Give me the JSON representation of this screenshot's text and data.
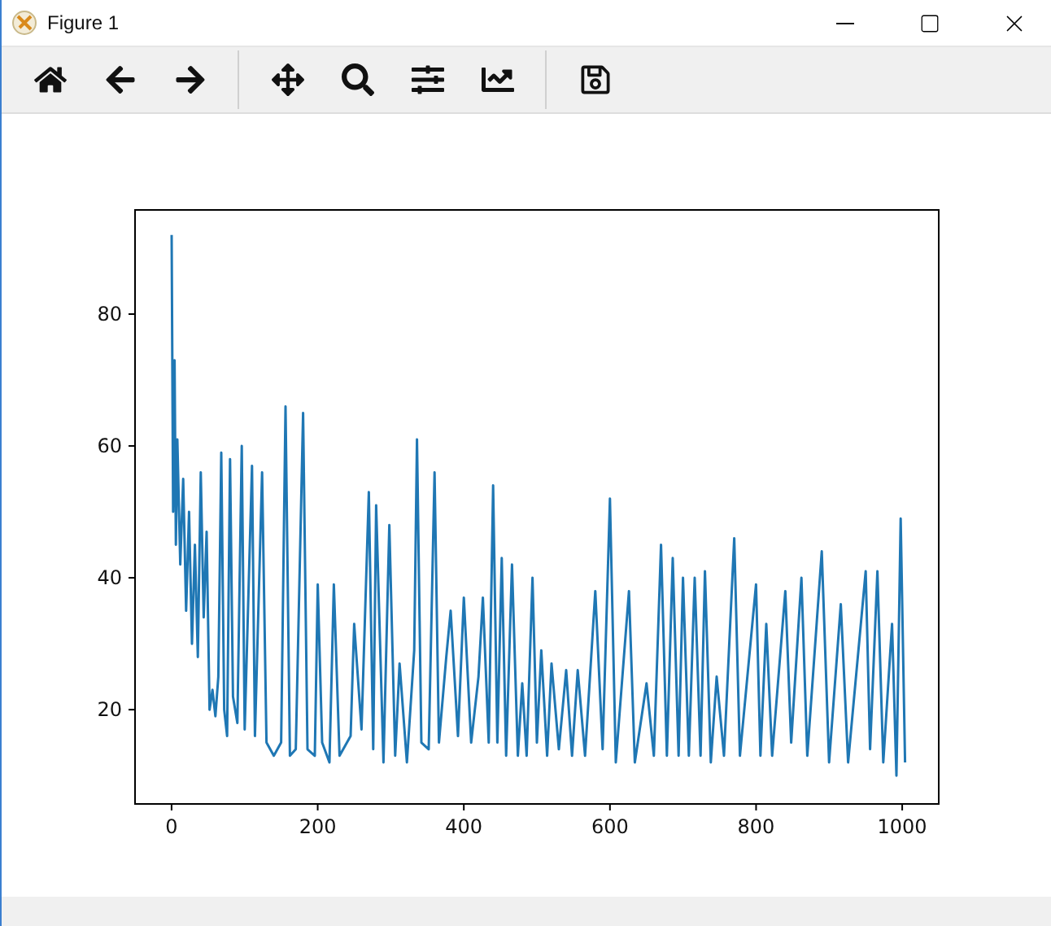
{
  "window": {
    "title": "Figure 1"
  },
  "figure": {
    "chart_data": {
      "type": "line",
      "xlim": [
        -50,
        1050
      ],
      "ylim": [
        5.7,
        95.8
      ],
      "xticks": [
        0,
        200,
        400,
        600,
        800,
        1000
      ],
      "yticks": [
        20,
        40,
        60,
        80
      ],
      "x": [
        0,
        2,
        4,
        6,
        8,
        12,
        16,
        20,
        24,
        28,
        32,
        36,
        40,
        44,
        48,
        52,
        56,
        60,
        64,
        68,
        72,
        76,
        80,
        84,
        90,
        96,
        100,
        110,
        114,
        124,
        130,
        140,
        150,
        156,
        162,
        170,
        180,
        186,
        196,
        200,
        206,
        216,
        222,
        230,
        245,
        250,
        260,
        270,
        276,
        280,
        290,
        298,
        306,
        312,
        322,
        332,
        336,
        342,
        352,
        360,
        366,
        376,
        382,
        392,
        400,
        410,
        420,
        426,
        434,
        440,
        446,
        452,
        458,
        466,
        474,
        480,
        486,
        494,
        500,
        506,
        514,
        520,
        530,
        540,
        548,
        556,
        566,
        580,
        590,
        600,
        608,
        626,
        634,
        650,
        660,
        670,
        678,
        686,
        694,
        700,
        708,
        716,
        724,
        730,
        738,
        746,
        756,
        770,
        778,
        800,
        806,
        814,
        822,
        840,
        848,
        862,
        870,
        890,
        900,
        916,
        926,
        950,
        956,
        966,
        974,
        986,
        992,
        998,
        1004
      ],
      "series": [
        {
          "color": "#1f77b4",
          "values": [
            92,
            50,
            73,
            45,
            61,
            42,
            55,
            35,
            50,
            30,
            45,
            28,
            56,
            34,
            47,
            20,
            23,
            19,
            25,
            59,
            20,
            16,
            58,
            22,
            18,
            60,
            17,
            57,
            16,
            56,
            15,
            13,
            15,
            66,
            13,
            14,
            65,
            14,
            13,
            39,
            15,
            12,
            39,
            13,
            16,
            33,
            17,
            53,
            14,
            51,
            12,
            48,
            13,
            27,
            12,
            29,
            61,
            15,
            14,
            56,
            15,
            28,
            35,
            16,
            37,
            15,
            25,
            37,
            15,
            54,
            15,
            43,
            13,
            42,
            13,
            24,
            13,
            40,
            15,
            29,
            13,
            27,
            14,
            26,
            13,
            26,
            13,
            38,
            14,
            52,
            12,
            38,
            12,
            24,
            13,
            45,
            13,
            43,
            13,
            40,
            13,
            40,
            13,
            41,
            12,
            25,
            13,
            46,
            13,
            39,
            13,
            33,
            13,
            38,
            15,
            40,
            13,
            44,
            12,
            36,
            12,
            41,
            14,
            41,
            12,
            33,
            10,
            49,
            12
          ]
        }
      ]
    }
  }
}
